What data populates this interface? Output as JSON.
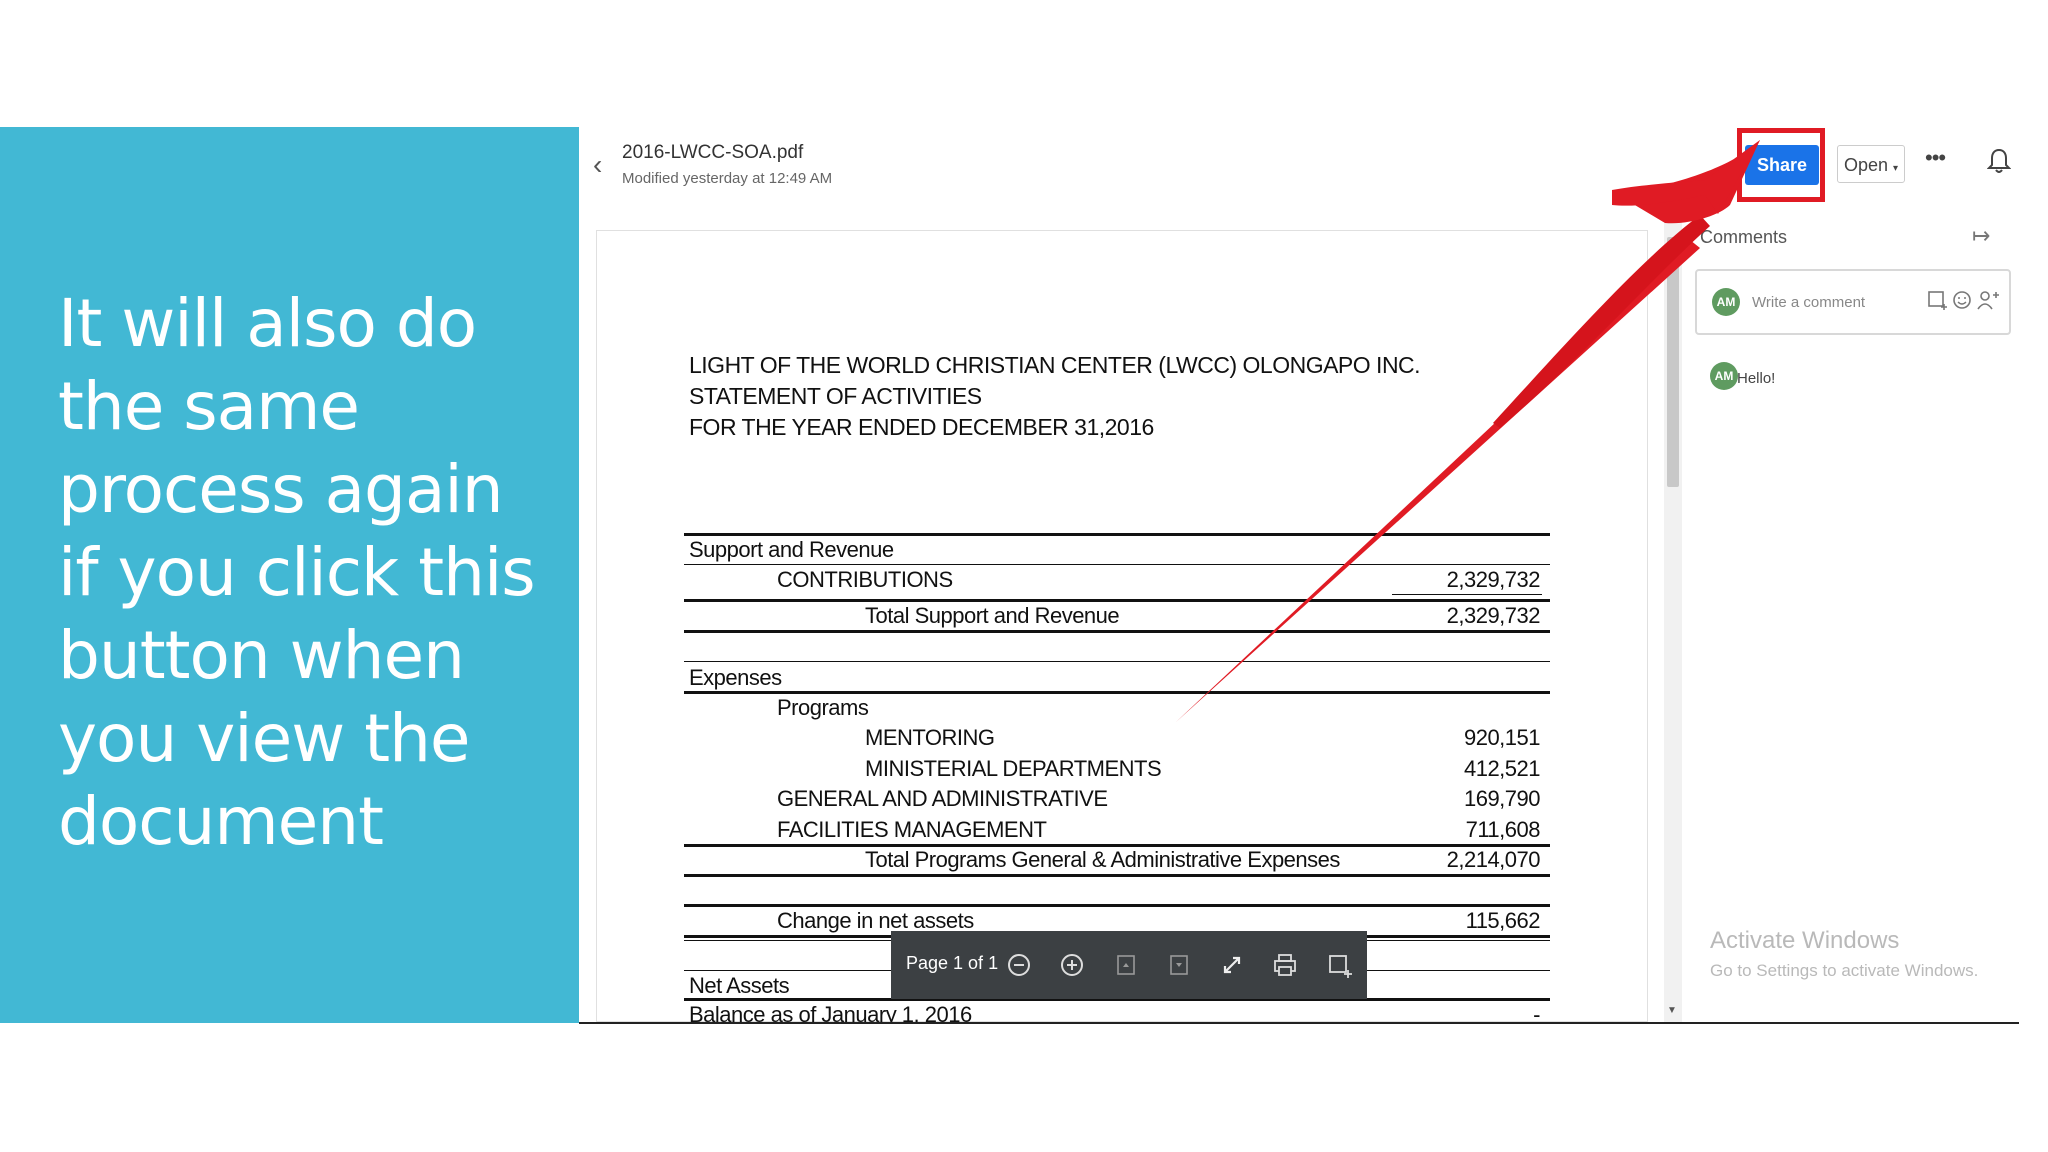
{
  "slide": {
    "text_lines": [
      "It will also do",
      "the same",
      "process again",
      "if you click this",
      "button when",
      "you view the",
      "document"
    ]
  },
  "header": {
    "file_name": "2016-LWCC-SOA.pdf",
    "modified": "Modified yesterday at 12:49 AM",
    "share_label": "Share",
    "open_label": "Open",
    "more_label": "•••"
  },
  "document": {
    "title_lines": [
      "LIGHT OF THE WORLD CHRISTIAN CENTER (LWCC) OLONGAPO INC.",
      "STATEMENT OF ACTIVITIES",
      "FOR THE YEAR ENDED DECEMBER 31,2016"
    ],
    "support_header": "Support and Revenue",
    "contributions": {
      "label": "CONTRIBUTIONS",
      "value": "2,329,732"
    },
    "total_support": {
      "label": "Total Support and Revenue",
      "value": "2,329,732"
    },
    "expenses_header": "Expenses",
    "programs_label": "Programs",
    "mentoring": {
      "label": "MENTORING",
      "value": "920,151"
    },
    "ministerial": {
      "label": "MINISTERIAL DEPARTMENTS",
      "value": "412,521"
    },
    "general": {
      "label": "GENERAL AND ADMINISTRATIVE",
      "value": "169,790"
    },
    "facilities": {
      "label": "FACILITIES MANAGEMENT",
      "value": "711,608"
    },
    "total_expenses": {
      "label": "Total Programs General & Administrative Expenses",
      "value": "2,214,070"
    },
    "change": {
      "label": "Change in net assets",
      "value": "115,662"
    },
    "net_assets_header": "Net Assets",
    "balance": {
      "label": "Balance as of January 1, 2016",
      "value": "-"
    }
  },
  "toolbar": {
    "page_label": "Page 1 of 1"
  },
  "sidebar": {
    "title": "Comments",
    "placeholder": "Write a comment",
    "avatar_initials": "AM",
    "comment_text": "Hello!",
    "activate_title": "Activate Windows",
    "activate_sub": "Go to Settings to activate Windows."
  },
  "colors": {
    "slide_bg": "#42b8d4",
    "share_blue": "#1a73e8",
    "arrow_red": "#e01b24",
    "toolbar_bg": "#3c4043"
  }
}
